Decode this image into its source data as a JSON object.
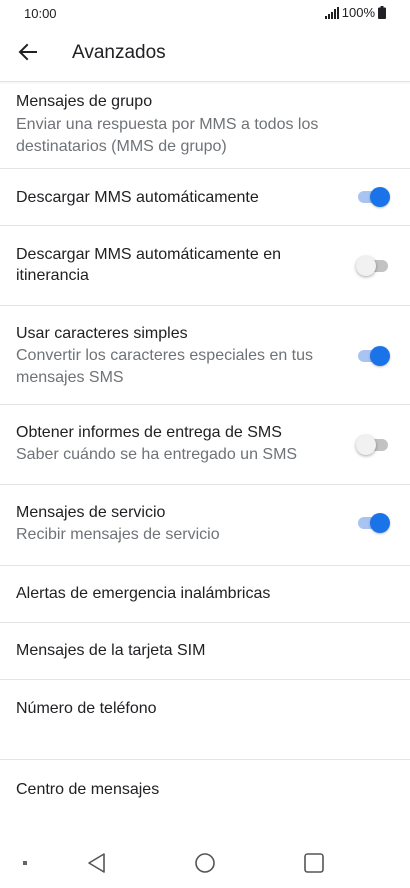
{
  "status_bar": {
    "time": "10:00",
    "battery": "100%",
    "icons": [
      "signal-icon",
      "battery-icon"
    ]
  },
  "app_bar": {
    "title": "Avanzados",
    "back_icon": "arrow-left-icon"
  },
  "settings": {
    "group_messages": {
      "title": "Mensajes de grupo",
      "summary": "Enviar una respuesta por MMS a todos los destinatarios (MMS de grupo)"
    },
    "auto_download_mms": {
      "title": "Descargar MMS automáticamente",
      "enabled": true
    },
    "auto_download_mms_roaming": {
      "title": "Descargar MMS automáticamente en itinerancia",
      "enabled": false
    },
    "simple_characters": {
      "title": "Usar caracteres simples",
      "summary": "Convertir los caracteres especiales en tus mensajes SMS",
      "enabled": true
    },
    "sms_delivery_reports": {
      "title": "Obtener informes de entrega de SMS",
      "summary": "Saber cuándo se ha entregado un SMS",
      "enabled": false
    },
    "service_messages": {
      "title": "Mensajes de servicio",
      "summary": "Recibir mensajes de servicio",
      "enabled": true
    },
    "wireless_emergency_alerts": {
      "title": "Alertas de emergencia inalámbricas"
    },
    "sim_card_messages": {
      "title": "Mensajes de la tarjeta SIM"
    },
    "phone_number": {
      "title": "Número de teléfono"
    },
    "message_center": {
      "title": "Centro de mensajes"
    }
  },
  "nav_bar": {
    "icons": [
      "recents-dot-icon",
      "back-triangle-icon",
      "home-circle-icon",
      "overview-square-icon"
    ]
  },
  "colors": {
    "accent": "#1a73e8",
    "accent_track": "#a9c4f1",
    "text_primary": "#202124",
    "text_secondary": "#6f7377",
    "divider": "#e4e4e4"
  }
}
